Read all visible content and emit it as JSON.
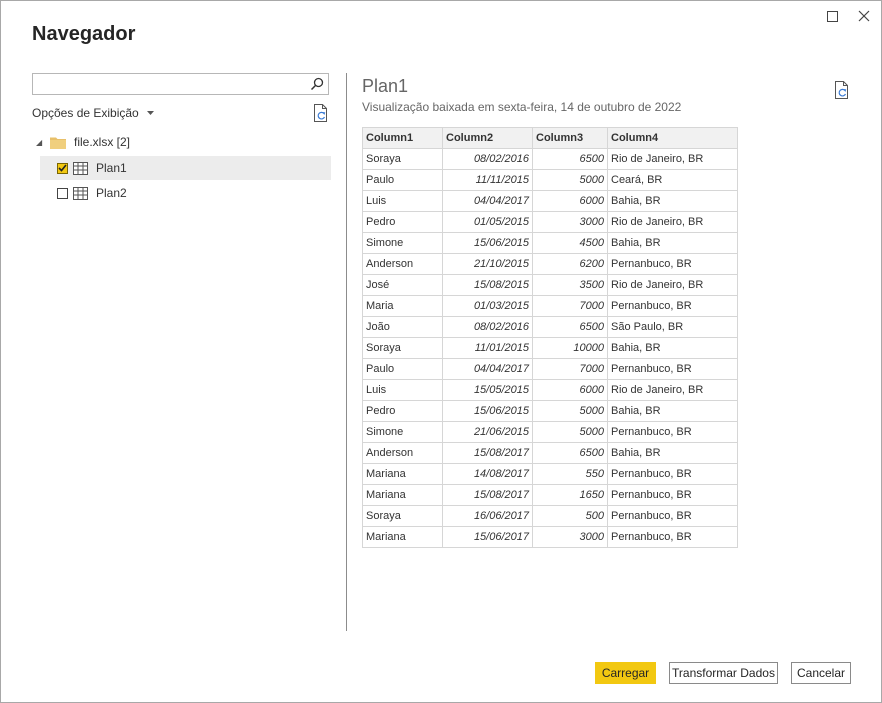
{
  "window": {
    "title": "Navegador",
    "maximize_icon": "maximize-icon",
    "close_icon": "close-icon"
  },
  "left_pane": {
    "search": {
      "value": "",
      "placeholder": ""
    },
    "view_options_label": "Opções de Exibição",
    "tree": {
      "file_label": "file.xlsx [2]",
      "items": [
        {
          "label": "Plan1",
          "checked": true,
          "selected": true
        },
        {
          "label": "Plan2",
          "checked": false,
          "selected": false
        }
      ]
    }
  },
  "preview": {
    "title": "Plan1",
    "subtitle": "Visualização baixada em sexta-feira, 14 de outubro de 2022",
    "columns": [
      "Column1",
      "Column2",
      "Column3",
      "Column4"
    ],
    "rows": [
      [
        "Soraya",
        "08/02/2016",
        "6500",
        "Rio de Janeiro, BR"
      ],
      [
        "Paulo",
        "11/11/2015",
        "5000",
        "Ceará, BR"
      ],
      [
        "Luis",
        "04/04/2017",
        "6000",
        "Bahia, BR"
      ],
      [
        "Pedro",
        "01/05/2015",
        "3000",
        "Rio de Janeiro, BR"
      ],
      [
        "Simone",
        "15/06/2015",
        "4500",
        "Bahia, BR"
      ],
      [
        "Anderson",
        "21/10/2015",
        "6200",
        "Pernanbuco, BR"
      ],
      [
        "José",
        "15/08/2015",
        "3500",
        "Rio de Janeiro, BR"
      ],
      [
        "Maria",
        "01/03/2015",
        "7000",
        "Pernanbuco, BR"
      ],
      [
        "João",
        "08/02/2016",
        "6500",
        "São Paulo, BR"
      ],
      [
        "Soraya",
        "11/01/2015",
        "10000",
        "Bahia, BR"
      ],
      [
        "Paulo",
        "04/04/2017",
        "7000",
        "Pernanbuco, BR"
      ],
      [
        "Luis",
        "15/05/2015",
        "6000",
        "Rio de Janeiro, BR"
      ],
      [
        "Pedro",
        "15/06/2015",
        "5000",
        "Bahia, BR"
      ],
      [
        "Simone",
        "21/06/2015",
        "5000",
        "Pernanbuco, BR"
      ],
      [
        "Anderson",
        "15/08/2017",
        "6500",
        "Bahia, BR"
      ],
      [
        "Mariana",
        "14/08/2017",
        "550",
        "Pernanbuco, BR"
      ],
      [
        "Mariana",
        "15/08/2017",
        "1650",
        "Pernanbuco, BR"
      ],
      [
        "Soraya",
        "16/06/2017",
        "500",
        "Pernanbuco, BR"
      ],
      [
        "Mariana",
        "15/06/2017",
        "3000",
        "Pernanbuco, BR"
      ]
    ]
  },
  "footer": {
    "load_label": "Carregar",
    "transform_label": "Transformar Dados",
    "cancel_label": "Cancelar"
  },
  "colors": {
    "accent": "#f2c811",
    "divider": "#8c8c8c",
    "header_bg": "#f1f1f1",
    "selected_row_bg": "#ececec"
  }
}
